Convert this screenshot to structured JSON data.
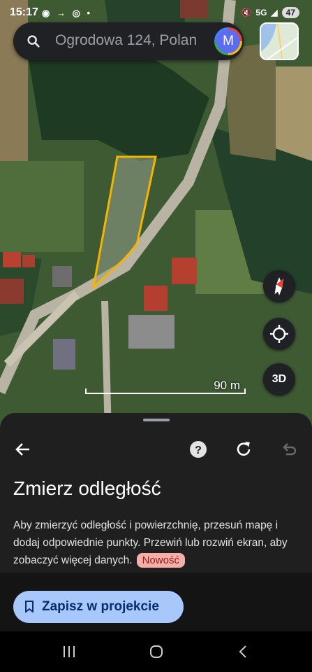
{
  "status": {
    "time": "15:17",
    "left_icons": "◉ → ◎ •",
    "signal": "5G",
    "battery": "47"
  },
  "search": {
    "text": "Ogrodowa 124, Polan",
    "avatar_letter": "M"
  },
  "map": {
    "scale_label": "90 m",
    "three_d_label": "3D"
  },
  "sheet": {
    "title": "Zmierz odległość",
    "description": "Aby zmierzyć odległość i powierzchnię, przesuń mapę i dodaj odpowiednie punkty. Przewiń lub rozwiń ekran, aby zobaczyć więcej danych.",
    "badge": "Nowość",
    "save_label": "Zapisz w projekcie"
  },
  "colors": {
    "measure_polygon": "#f4b400",
    "button_bg": "#a8c7fa",
    "badge_bg": "#f6aea9"
  },
  "icons": [
    "search-icon",
    "back-arrow-icon",
    "help-icon",
    "refresh-icon",
    "undo-icon",
    "compass-icon",
    "my-location-icon",
    "bookmark-icon"
  ]
}
